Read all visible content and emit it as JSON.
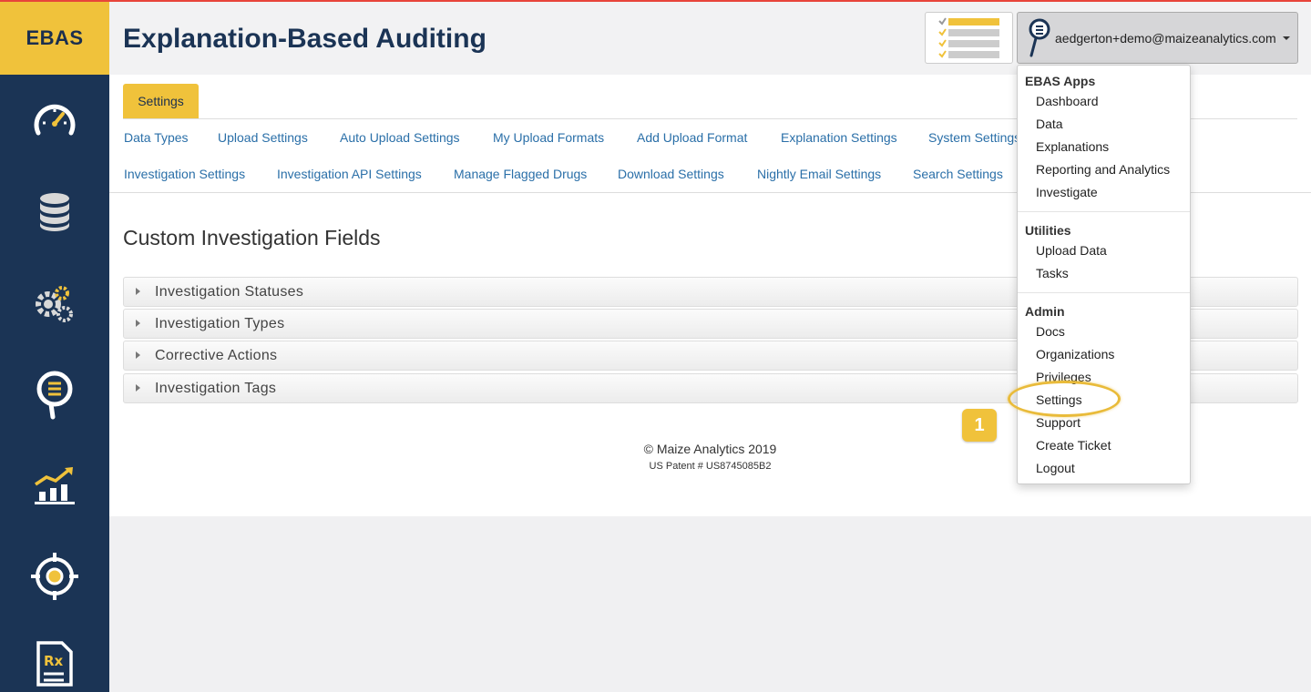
{
  "brand": {
    "logo_text": "EBAS",
    "accent": "#f0c23b",
    "sidebar_color": "#1b3455"
  },
  "header": {
    "title": "Explanation-Based Auditing",
    "user_email": "aedgerton+demo@maizeanalytics.com"
  },
  "sidebar": {
    "icons": [
      "dashboard-gauge-icon",
      "database-icon",
      "gears-icon",
      "investigate-magnifier-icon",
      "analytics-chart-icon",
      "target-icon",
      "rx-document-icon"
    ]
  },
  "settings_tab": {
    "label": "Settings"
  },
  "links_row1": [
    "Data Types",
    "Upload Settings",
    "Auto Upload Settings",
    "My Upload Formats",
    "Add Upload Format",
    "Explanation Settings",
    "System Settings"
  ],
  "links_row2": [
    "Investigation Settings",
    "Investigation API Settings",
    "Manage Flagged Drugs",
    "Download Settings",
    "Nightly Email Settings",
    "Search Settings"
  ],
  "section": {
    "title": "Custom Investigation Fields",
    "accordions": [
      "Investigation Statuses",
      "Investigation Types",
      "Corrective Actions",
      "Investigation Tags"
    ]
  },
  "footer": {
    "copyright": "© Maize Analytics 2019",
    "patent": "US Patent # US8745085B2"
  },
  "dropdown": {
    "groups": [
      {
        "heading": "EBAS Apps",
        "items": [
          "Dashboard",
          "Data",
          "Explanations",
          "Reporting and Analytics",
          "Investigate"
        ]
      },
      {
        "heading": "Utilities",
        "items": [
          "Upload Data",
          "Tasks"
        ]
      },
      {
        "heading": "Admin",
        "items": [
          "Docs",
          "Organizations",
          "Privileges",
          "Settings",
          "Support",
          "Create Ticket",
          "Logout"
        ]
      }
    ]
  },
  "callout": {
    "step": "1",
    "target": "Settings"
  }
}
